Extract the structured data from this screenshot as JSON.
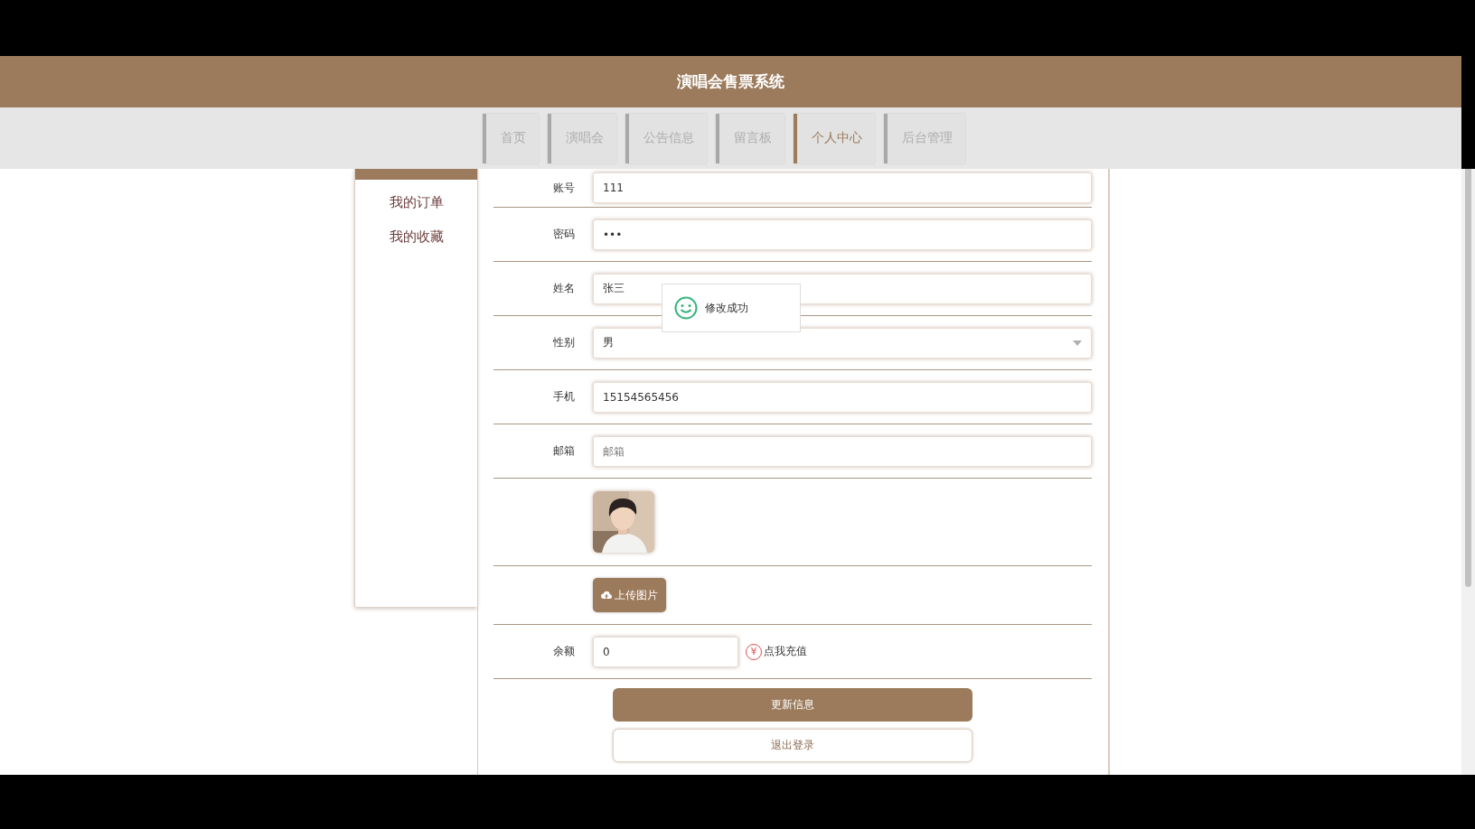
{
  "title": "演唱会售票系统",
  "nav": [
    {
      "label": "首页",
      "selected": false
    },
    {
      "label": "演唱会",
      "selected": false
    },
    {
      "label": "公告信息",
      "selected": false
    },
    {
      "label": "留言板",
      "selected": false
    },
    {
      "label": "个人中心",
      "selected": true
    },
    {
      "label": "后台管理",
      "selected": false
    }
  ],
  "sidebar": {
    "items": [
      {
        "label": "我的订单"
      },
      {
        "label": "我的收藏"
      }
    ]
  },
  "form": {
    "fields": [
      {
        "label": "账号",
        "kind": "text",
        "value": "111"
      },
      {
        "label": "密码",
        "kind": "text",
        "value": "•••"
      },
      {
        "label": "姓名",
        "kind": "text",
        "value": "张三"
      },
      {
        "label": "性别",
        "kind": "select",
        "value": "男"
      },
      {
        "label": "手机",
        "kind": "text",
        "value": "15154565456"
      },
      {
        "label": "邮箱",
        "kind": "text",
        "placeholder": "邮箱"
      }
    ],
    "upload_button": "上传图片",
    "balance": {
      "label": "余额",
      "value": "0"
    },
    "recharge": {
      "icon": "¥",
      "label": "点我充值"
    },
    "buttons": [
      {
        "label": "更新信息",
        "kind": "primary"
      },
      {
        "label": "退出登录",
        "kind": "secondary"
      }
    ]
  },
  "toast": {
    "message": "修改成功"
  }
}
